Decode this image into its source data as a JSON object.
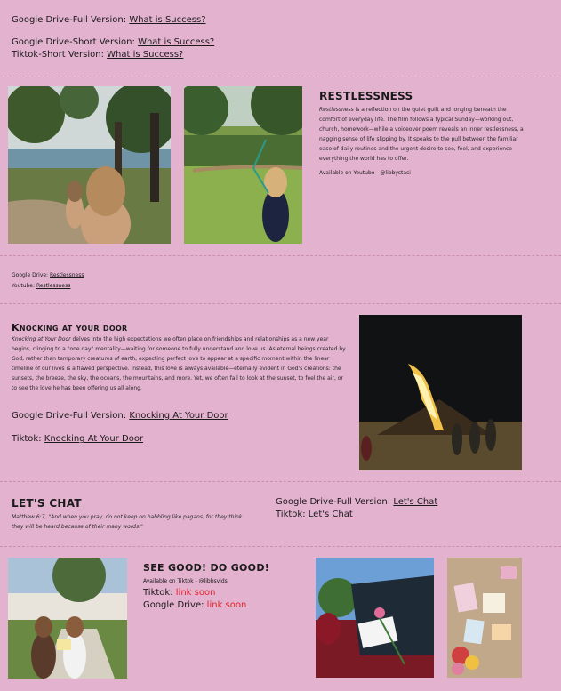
{
  "top": {
    "line1_label": "Google Drive-Full Version:",
    "line1_link": "What is Success?",
    "line2_label": "Google Drive-Short Version:",
    "line2_link": "What is Success?",
    "line3_label": "Tiktok-Short Version:",
    "line3_link": "What is Success?"
  },
  "restlessness": {
    "title": "RESTLESSNESS",
    "desc_italic": "Restlessness",
    "desc": " is a reflection on the quiet guilt and longing beneath the comfort of everyday life. The film follows a typical Sunday—working out, church, homework—while a voiceover poem reveals an inner restlessness, a nagging sense of life slipping by. It speaks to the pull between the familiar ease of daily routines and the urgent desire to see, feel, and experience everything the world has to offer.",
    "available": "Available on Youtube - @libbystasi",
    "gdrive_label": "Google Drive:",
    "gdrive_link": "Restlessness",
    "youtube_label": "Youtube:",
    "youtube_link": "Restlessness"
  },
  "knocking": {
    "title": "Knocking at your door",
    "desc_italic": "Knocking at Your Door",
    "desc": " delves into the high expectations we often place on friendships and relationships as a new year begins, clinging to a \"one day\" mentality—waiting for someone to fully understand and love us. As eternal beings created by God, rather than temporary creatures of earth, expecting perfect love to appear at a specific moment within the linear timeline of our lives is a flawed perspective. Instead, this love is always available—eternally evident in God's creations: the sunsets, the breeze, the sky, the oceans, the mountains, and more. Yet, we often fail to look at the sunset, to feel the air, or to see the love he has been offering us all along.",
    "gdrive_label": "Google Drive-Full Version:",
    "gdrive_link": "Knocking At Your Door",
    "tiktok_label": "Tiktok:",
    "tiktok_link": "Knocking At Your Door"
  },
  "chat": {
    "title": "LET'S CHAT",
    "quote": "Matthew 6:7, \"And when you pray, do not keep on babbling like pagans, for they think they will be heard because of their many words.\"",
    "gdrive_label": "Google Drive-Full Version:",
    "gdrive_link": "Let's Chat",
    "tiktok_label": "Tiktok:",
    "tiktok_link": "Let's Chat"
  },
  "seegood": {
    "title": "SEE GOOD! DO GOOD!",
    "available": "Available on Tiktok - @libbsvids",
    "tiktok_label": "Tiktok:",
    "tiktok_value": "link soon",
    "gdrive_label": "Google Drive:",
    "gdrive_value": "link soon"
  },
  "colors": {
    "background": "#e3b2cf",
    "link_soon": "#e8202a"
  }
}
